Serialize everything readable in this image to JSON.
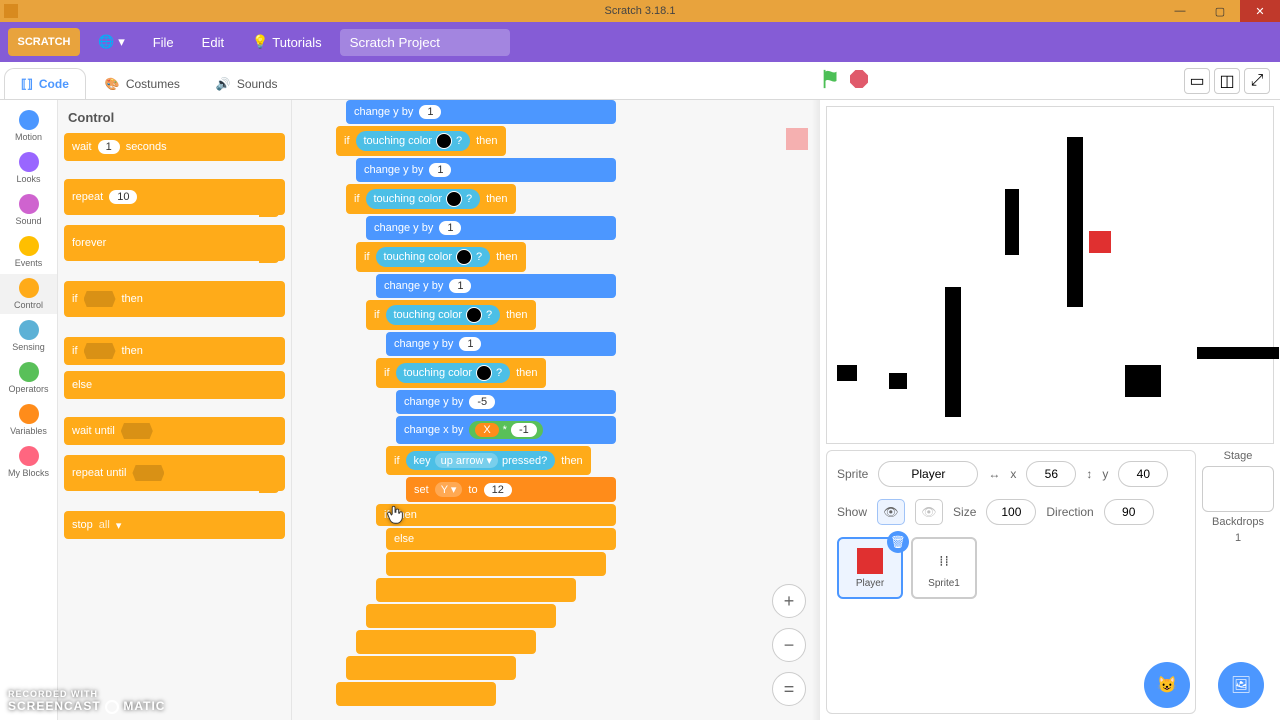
{
  "titlebar": {
    "title": "Scratch 3.18.1"
  },
  "menu": {
    "file": "File",
    "edit": "Edit",
    "tutorials": "Tutorials",
    "project_name": "Scratch Project",
    "logo": "SCRATCH"
  },
  "tabs": {
    "code": "Code",
    "costumes": "Costumes",
    "sounds": "Sounds"
  },
  "categories": [
    {
      "name": "Motion",
      "color": "#4c97ff"
    },
    {
      "name": "Looks",
      "color": "#9966ff"
    },
    {
      "name": "Sound",
      "color": "#cf63cf"
    },
    {
      "name": "Events",
      "color": "#ffbf00"
    },
    {
      "name": "Control",
      "color": "#ffab19",
      "active": true
    },
    {
      "name": "Sensing",
      "color": "#5cb1d6"
    },
    {
      "name": "Operators",
      "color": "#59c059"
    },
    {
      "name": "Variables",
      "color": "#ff8c1a"
    },
    {
      "name": "My Blocks",
      "color": "#ff6680"
    }
  ],
  "palette": {
    "title": "Control",
    "wait": "wait",
    "wait_val": "1",
    "seconds": "seconds",
    "repeat": "repeat",
    "repeat_val": "10",
    "forever": "forever",
    "if": "if",
    "then": "then",
    "else": "else",
    "wait_until": "wait until",
    "repeat_until": "repeat until",
    "stop": "stop",
    "stop_opt": "all"
  },
  "blocks": {
    "change_y_by": "change y by",
    "change_x_by": "change x by",
    "if": "if",
    "then": "then",
    "else": "else",
    "touching_color": "touching color",
    "q": "?",
    "key": "key",
    "up_arrow": "up arrow",
    "pressed": "pressed?",
    "set": "set",
    "to": "to",
    "v1": "1",
    "vneg5": "-5",
    "vneg1": "-1",
    "v12": "12",
    "varX": "X",
    "varY": "Y",
    "star": "*"
  },
  "sprite_panel": {
    "sprite_lbl": "Sprite",
    "sprite_name": "Player",
    "x_lbl": "x",
    "x_val": "56",
    "y_lbl": "y",
    "y_val": "40",
    "show_lbl": "Show",
    "size_lbl": "Size",
    "size_val": "100",
    "dir_lbl": "Direction",
    "dir_val": "90"
  },
  "thumbs": {
    "player": "Player",
    "sprite1": "Sprite1"
  },
  "stage_col": {
    "title": "Stage",
    "backdrops": "Backdrops",
    "count": "1"
  },
  "watermark": {
    "line1": "RECORDED WITH",
    "line2a": "SCREENCAST",
    "line2b": "MATIC"
  }
}
